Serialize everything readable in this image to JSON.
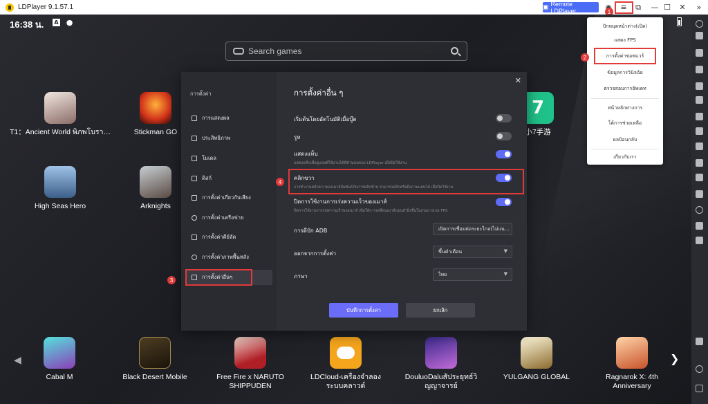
{
  "window": {
    "title": "LDPlayer 9.1.57.1",
    "remote_label": "Remote LDPlayer",
    "accent": "#4a6cf7"
  },
  "status_bar": {
    "time": "16:38 น."
  },
  "search": {
    "placeholder": "Search games"
  },
  "apps_top": [
    {
      "label": "T1：Ancient World พิภพโบรา…",
      "icon": "app-icon-t1",
      "color": "#c9b8b0"
    },
    {
      "label": "Stickman GO",
      "icon": "app-icon-stickman",
      "color": "#e84a1c"
    },
    {
      "label": "小7手游",
      "icon": "app-icon-xiao7",
      "color": "#1fc28a"
    },
    {
      "label": "High Seas Hero",
      "icon": "app-icon-highseas",
      "color": "#6a8fb6"
    },
    {
      "label": "Arknights",
      "icon": "app-icon-arknights",
      "color": "#9aa3a8"
    }
  ],
  "apps_bottom": [
    {
      "label": "Cabal M",
      "icon": "app-icon-cabal",
      "color": "#2cc6c1"
    },
    {
      "label": "Black Desert Mobile",
      "icon": "app-icon-blackdesert",
      "color": "#3a2e1d"
    },
    {
      "label": "Free Fire x NARUTO SHIPPUDEN",
      "label_line1": "Free Fire x NARUTO",
      "label_line2": "SHIPPUDEN",
      "icon": "app-icon-freefire",
      "color": "#b01e26"
    },
    {
      "label": "LDCloud-เครื่องจำลองระบบคลาวด์",
      "label_line1": "LDCloud-เครื่องจำลอง",
      "label_line2": "ระบบคลาวด์",
      "icon": "app-icon-ldcloud",
      "color": "#f5a51c"
    },
    {
      "label": "DouluoDaluสัประยุทธ์วิญญาจารย์",
      "label_line1": "DouluoDaluสัประยุทธ์วิ",
      "label_line2": "ญญาจารย์",
      "icon": "app-icon-douluo",
      "color": "#6a46c8"
    },
    {
      "label": "YULGANG GLOBAL",
      "icon": "app-icon-yulgang",
      "color": "#e8e0c0"
    },
    {
      "label": "Ragnarok X: 4th Anniversary",
      "label_line1": "Ragnarok X: 4th",
      "label_line2": "Anniversary",
      "icon": "app-icon-ragnarok",
      "color": "#e0925a"
    }
  ],
  "menu": {
    "items": [
      "ปักหมุดหน้าต่าง(เปิด)",
      "แสดง FPS",
      "การตั้งค่าซอฟแวร์",
      "ข้อมูลการวินิจฉัย",
      "ตรวจสอบการอัพเดท",
      "หน้าหลักทางการ",
      "ได้การช่วยเหลือ",
      "ผลป้อนกลับ",
      "เกี่ยวกับเรา"
    ]
  },
  "steps": [
    "1",
    "2",
    "3",
    "4"
  ],
  "settings": {
    "sidebar_title": "การตั้งค่า",
    "nav": [
      {
        "label": "การแสดงผล",
        "icon": "monitor-icon"
      },
      {
        "label": "ประสิทธิภาพ",
        "icon": "performance-icon"
      },
      {
        "label": "โมเดล",
        "icon": "folder-icon"
      },
      {
        "label": "ดิสก์",
        "icon": "disk-icon"
      },
      {
        "label": "การตั้งค่าเกี่ยวกับเสียง",
        "icon": "sound-icon"
      },
      {
        "label": "การตั้งค่าเครือข่าย",
        "icon": "network-icon"
      },
      {
        "label": "การตั้งค่าคีย์ลัด",
        "icon": "keyboard-icon"
      },
      {
        "label": "การตั้งค่าภาพพื้นหลัง",
        "icon": "wallpaper-icon"
      },
      {
        "label": "การตั้งค่าอื่นๆ",
        "icon": "grid-icon"
      }
    ],
    "active_nav": 8,
    "title": "การตั้งค่าอื่น ๆ",
    "options": [
      {
        "label": "เริ่มต้นโดยอัตโนมัติเมื่อบู๊ต",
        "desc": "",
        "on": false
      },
      {
        "label": "รูท",
        "desc": "",
        "on": false
      },
      {
        "label": "แสดงแท็บ",
        "desc": "แสดงแท็บเพื่อดูแอพที่ใช้งานได้ที่ด้านบนของ LDPlayer เมื่อปิดใช้งาน",
        "on": true
      },
      {
        "label": "คลิกขวา",
        "desc": "การทำงานคลิกขวาของเมาส์สัมพันธ์กับการคลิกซ้าย สามารถคลิกหรือดึงภาพแผนได้ เมื่อปิดใช้งาน",
        "on": true
      },
      {
        "label": "ปิดการใช้งานการเร่งความเร็วของเมาส์",
        "desc": "ปิดการใช้งานการเร่งความเร็วของเมาส์ เพื่อให้การเคลื่อนเมาส์แม่นยำยิ่งขึ้นในเกมบางเกม FPS",
        "on": true
      }
    ],
    "selects": [
      {
        "label": "การดีบัก ADB",
        "value": "เปิดการเชื่อมต่อระยะไกล(ไม่แน…"
      },
      {
        "label": "ออกจากการตั้งค่า",
        "value": "ขึ้นคำเตือน"
      },
      {
        "label": "ภาษา",
        "value": "ไทย"
      }
    ],
    "save_label": "บันทึกการตั้งค่า",
    "cancel_label": "ยกเลิก",
    "accent": "#5e6cf7"
  },
  "highlight_color": "#e03a3a"
}
